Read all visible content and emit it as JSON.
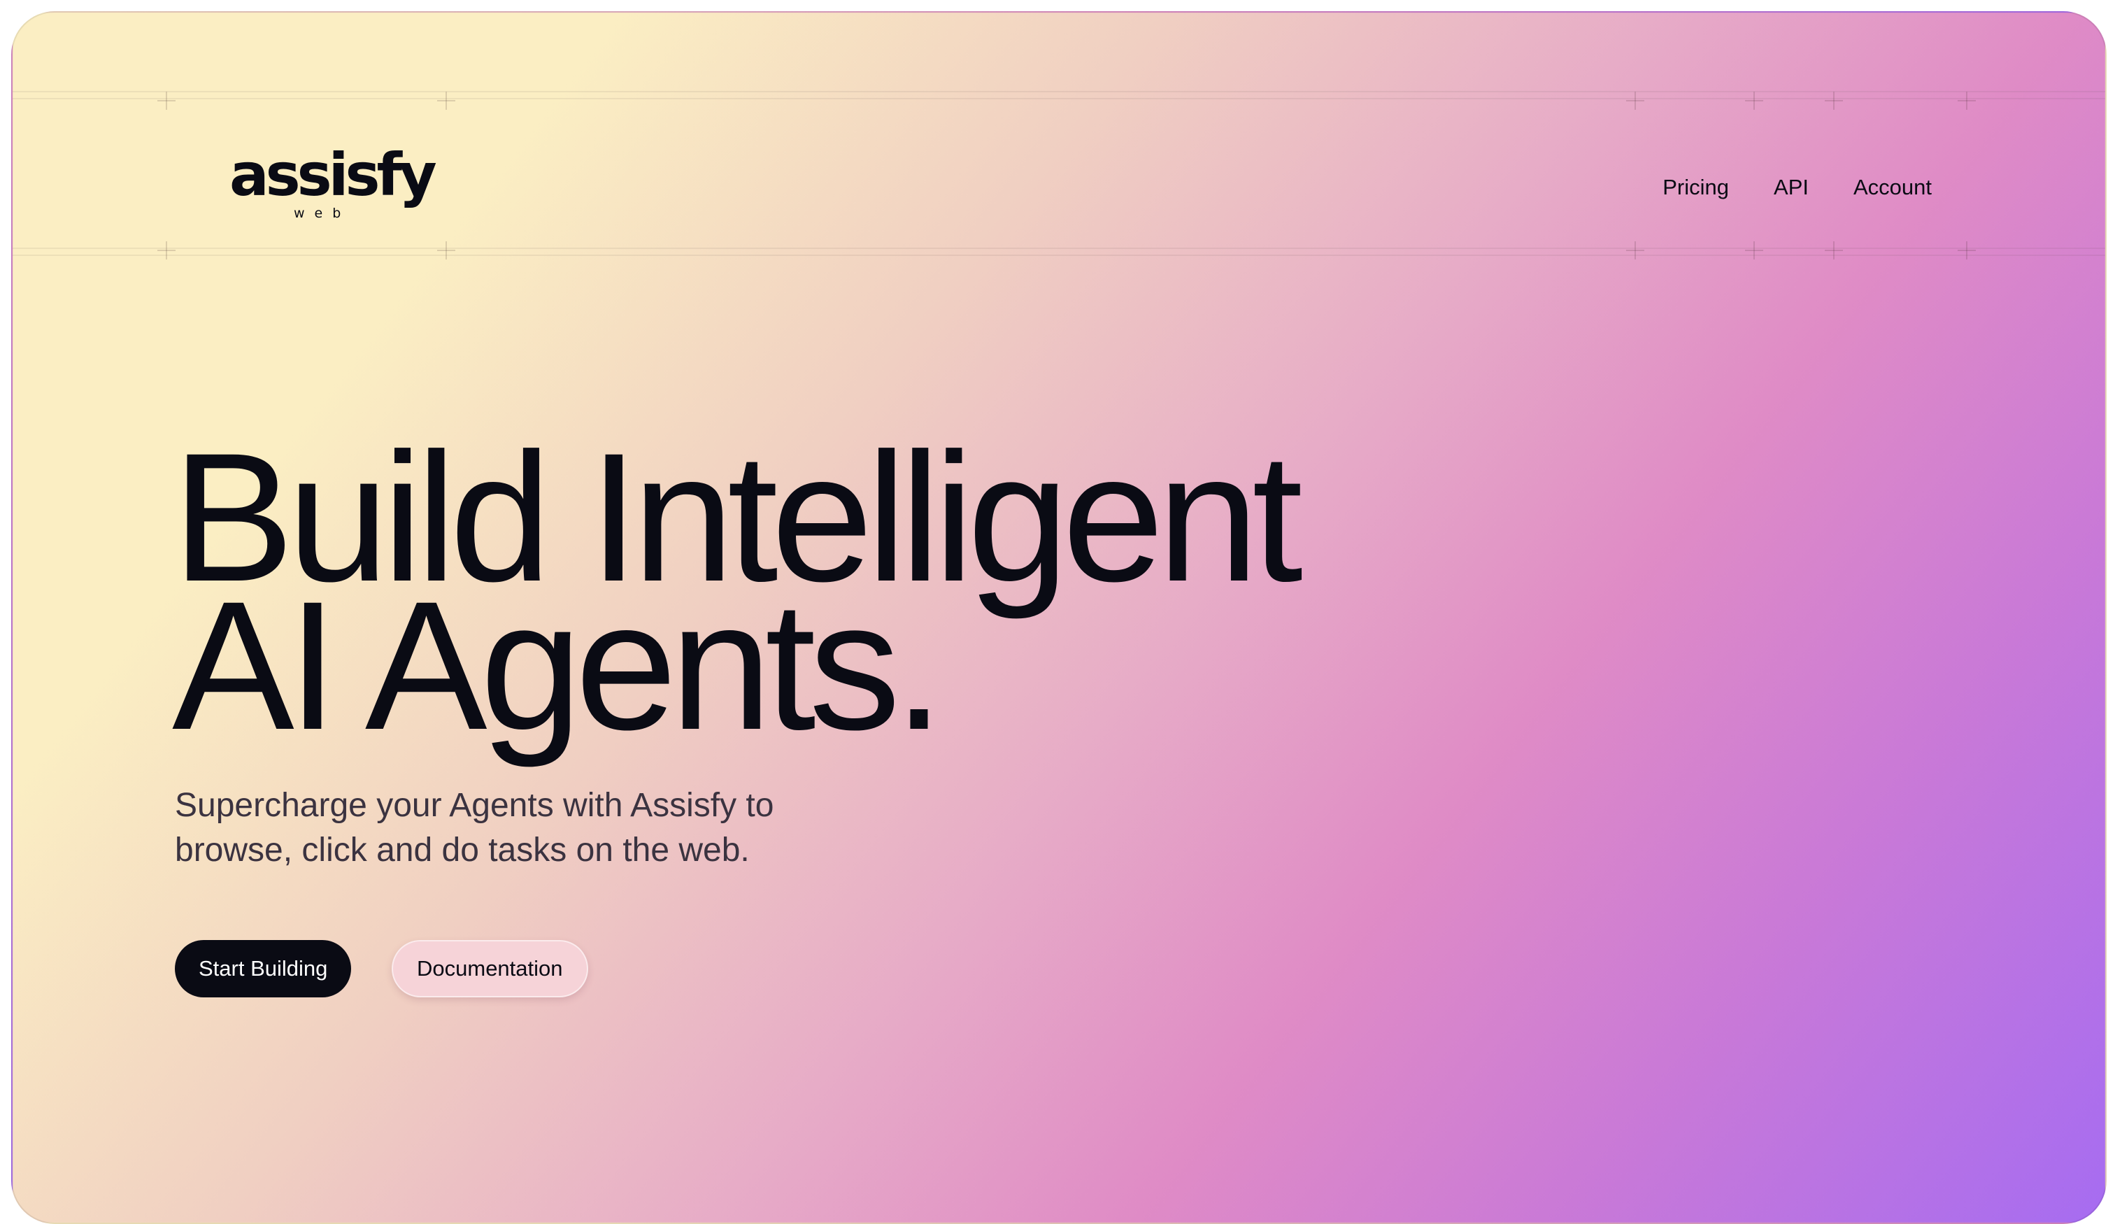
{
  "brand": {
    "logo_text": "assisfy",
    "logo_subtext": "web"
  },
  "nav": {
    "items": [
      {
        "label": "Pricing"
      },
      {
        "label": "API"
      },
      {
        "label": "Account"
      }
    ]
  },
  "hero": {
    "title_line1": "Build Intelligent",
    "title_line2": "AI Agents.",
    "subtitle_line1": "Supercharge your Agents with Assisfy to",
    "subtitle_line2": "browse, click and do tasks on the web.",
    "primary_cta": "Start Building",
    "secondary_cta": "Documentation"
  },
  "colors": {
    "gradient_start": "#fbeec3",
    "gradient_mid": "#df8bc6",
    "gradient_end": "#a66cf1",
    "text_dark": "#0a0b14",
    "primary_button": "#0a0b14",
    "secondary_button": "#f6d3d8"
  }
}
